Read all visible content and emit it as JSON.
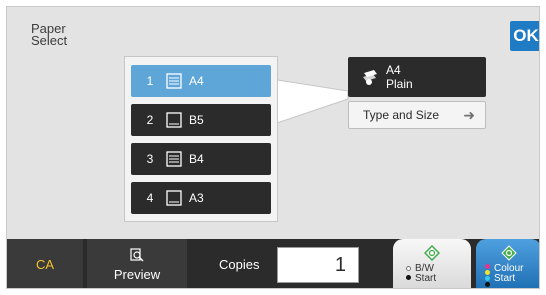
{
  "header": {
    "title": "Paper\nSelect",
    "ok_label": "OK"
  },
  "trays": [
    {
      "number": "1",
      "size": "A4",
      "selected": true,
      "icon": "stacked-paper-icon"
    },
    {
      "number": "2",
      "size": "B5",
      "selected": false,
      "icon": "empty-tray-icon"
    },
    {
      "number": "3",
      "size": "B4",
      "selected": false,
      "icon": "stacked-paper-icon"
    },
    {
      "number": "4",
      "size": "A3",
      "selected": false,
      "icon": "empty-tray-icon"
    }
  ],
  "selected_media": {
    "size": "A4",
    "type": "Plain",
    "icon": "paper-tray-icon"
  },
  "type_size_button": {
    "label": "Type and Size",
    "icon": "arrow-right-icon"
  },
  "bottom_bar": {
    "ca_label": "CA",
    "preview_label": "Preview",
    "copies_label": "Copies",
    "copies_value": "1",
    "bw_start": "B/W\nStart",
    "colour_start": "Colour\nStart"
  },
  "colors": {
    "accent_blue": "#1f7cc4",
    "selected_tray": "#5fa6d8",
    "dark_button": "#2b2b2b",
    "ca_text": "#f2c22b",
    "start_green": "#3fae49"
  }
}
